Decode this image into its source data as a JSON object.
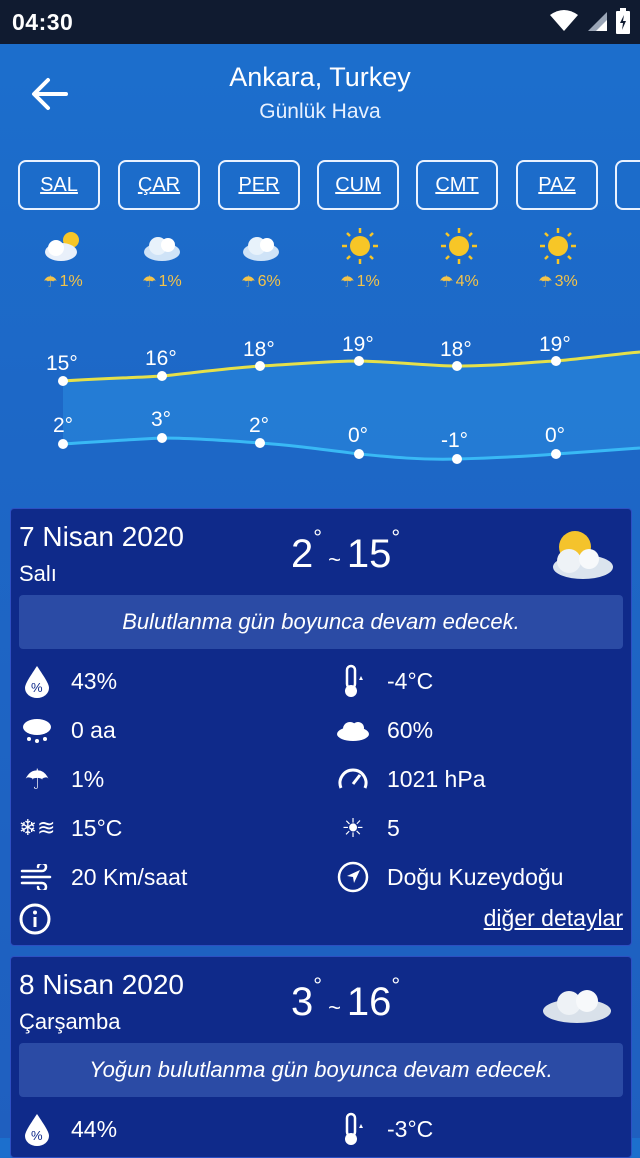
{
  "status_bar": {
    "time": "04:30"
  },
  "header": {
    "title": "Ankara, Turkey",
    "subtitle": "Günlük Hava"
  },
  "day_tabs": [
    "SAL",
    "ÇAR",
    "PER",
    "CUM",
    "CMT",
    "PAZ"
  ],
  "forecast": [
    {
      "icon": "partly-cloudy-icon",
      "rain": "1%",
      "high": "15°",
      "low": "2°"
    },
    {
      "icon": "cloudy-icon",
      "rain": "1%",
      "high": "16°",
      "low": "3°"
    },
    {
      "icon": "cloudy-icon",
      "rain": "6%",
      "high": "18°",
      "low": "2°"
    },
    {
      "icon": "sun-icon",
      "rain": "1%",
      "high": "19°",
      "low": "0°"
    },
    {
      "icon": "sun-icon",
      "rain": "4%",
      "high": "18°",
      "low": "-1°"
    },
    {
      "icon": "sun-icon",
      "rain": "3%",
      "high": "19°",
      "low": "0°"
    }
  ],
  "cards": [
    {
      "date": "7 Nisan 2020",
      "weekday": "Salı",
      "low": "2",
      "high": "15",
      "summary": "Bulutlanma gün boyunca devam edecek.",
      "metrics": {
        "humidity": "43%",
        "precip": "0 aa",
        "rain_chance": "1%",
        "feels_like": "15°C",
        "wind": "20 Km/saat",
        "dew_point": "-4°C",
        "cloud": "60%",
        "pressure": "1021 hPa",
        "uv": "5",
        "direction": "Doğu Kuzeydoğu"
      },
      "more": "diğer detaylar"
    },
    {
      "date": "8 Nisan 2020",
      "weekday": "Çarşamba",
      "low": "3",
      "high": "16",
      "summary": "Yoğun bulutlanma gün boyunca devam edecek.",
      "metrics": {
        "humidity": "44%",
        "dew_point": "-3°C"
      }
    }
  ],
  "colors": {
    "high_line": "#e5e04a",
    "low_line": "#39b9f5",
    "rain_text": "#f3c34a",
    "card_bg": "#0f2a8a"
  }
}
